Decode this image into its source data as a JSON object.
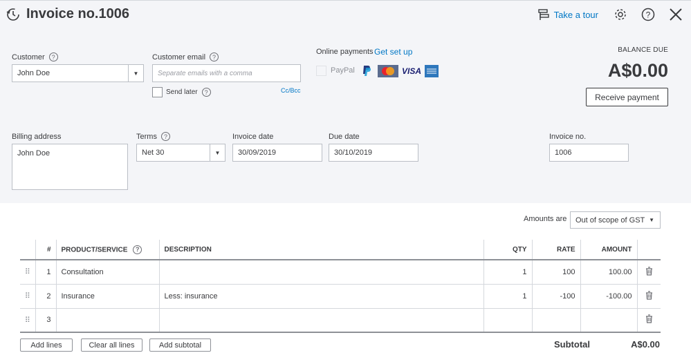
{
  "header": {
    "title": "Invoice no.1006",
    "tour_label": "Take a tour"
  },
  "customer": {
    "label": "Customer",
    "value": "John Doe"
  },
  "email": {
    "label": "Customer email",
    "placeholder": "Separate emails with a comma",
    "send_later": "Send later",
    "cc_bcc": "Cc/Bcc"
  },
  "online": {
    "label": "Online payments",
    "setup": "Get set up",
    "paypal": "PayPal",
    "visa": "VISA"
  },
  "balance": {
    "label": "BALANCE DUE",
    "value": "A$0.00",
    "receive_label": "Receive payment"
  },
  "billing": {
    "label": "Billing address",
    "value": "John Doe"
  },
  "terms": {
    "label": "Terms",
    "value": "Net 30"
  },
  "invoice_date": {
    "label": "Invoice date",
    "value": "30/09/2019"
  },
  "due_date": {
    "label": "Due date",
    "value": "30/10/2019"
  },
  "invoice_no": {
    "label": "Invoice no.",
    "value": "1006"
  },
  "amounts": {
    "label": "Amounts are",
    "value": "Out of scope of GST"
  },
  "table": {
    "headers": {
      "num": "#",
      "product": "PRODUCT/SERVICE",
      "description": "DESCRIPTION",
      "qty": "QTY",
      "rate": "RATE",
      "amount": "AMOUNT"
    },
    "rows": [
      {
        "num": "1",
        "product": "Consultation",
        "description": "",
        "qty": "1",
        "rate": "100",
        "amount": "100.00"
      },
      {
        "num": "2",
        "product": "Insurance",
        "description": "Less: insurance",
        "qty": "1",
        "rate": "-100",
        "amount": "-100.00"
      },
      {
        "num": "3",
        "product": "",
        "description": "",
        "qty": "",
        "rate": "",
        "amount": ""
      }
    ]
  },
  "footer": {
    "add_lines": "Add lines",
    "clear_lines": "Clear all lines",
    "add_subtotal": "Add subtotal",
    "subtotal_label": "Subtotal",
    "subtotal_value": "A$0.00"
  }
}
